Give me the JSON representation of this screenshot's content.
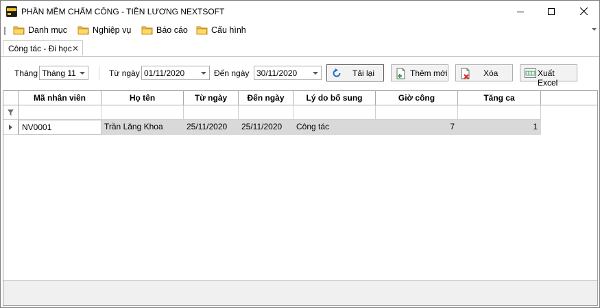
{
  "window": {
    "title": "PHẦN MỀM CHẤM CÔNG - TIỀN LƯƠNG NEXTSOFT",
    "icon": "app-logo-icon"
  },
  "menu": {
    "items": [
      {
        "label": "Danh mục",
        "icon": "folder-icon"
      },
      {
        "label": "Nghiệp vụ",
        "icon": "folder-icon"
      },
      {
        "label": "Báo cáo",
        "icon": "folder-icon"
      },
      {
        "label": "Cấu hình",
        "icon": "folder-icon"
      }
    ]
  },
  "tabs": [
    {
      "label": "Công tác - Đi học",
      "close": "✕"
    }
  ],
  "filters": {
    "month_label": "Tháng",
    "month_value": "Tháng 11",
    "from_label": "Từ ngày",
    "from_value": "01/11/2020",
    "to_label": "Đến ngày",
    "to_value": "30/11/2020"
  },
  "toolbar": {
    "reload_label": "Tải lại",
    "add_label": "Thêm mới",
    "delete_label": "Xóa",
    "export_label": "Xuất Excel"
  },
  "grid": {
    "columns": [
      "Mã nhân viên",
      "Họ tên",
      "Từ ngày",
      "Đến ngày",
      "Lý do bổ sung",
      "Giờ công",
      "Tăng ca"
    ],
    "rows": [
      [
        "NV0001",
        "Trần Lăng Khoa",
        "25/11/2020",
        "25/11/2020",
        "Công tác",
        "7",
        "1"
      ]
    ]
  },
  "colors": {
    "row_bg": "#d9d9d9",
    "folder": "#f2c24c"
  }
}
